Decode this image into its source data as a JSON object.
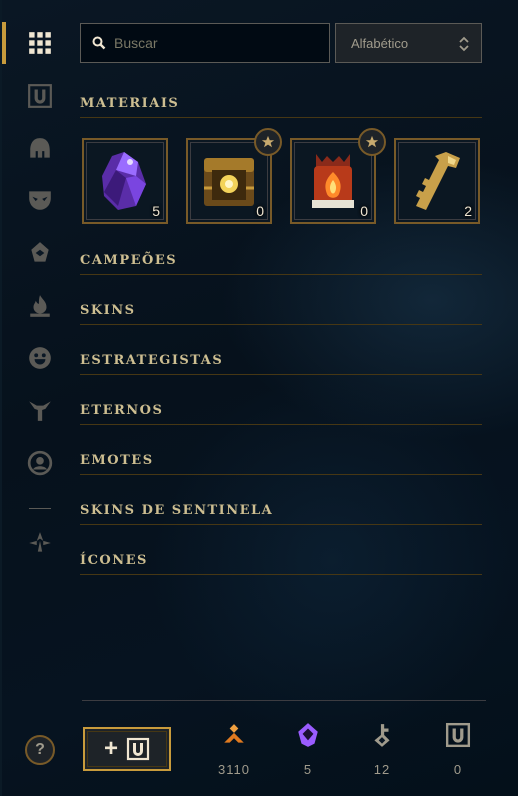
{
  "search": {
    "placeholder": "Buscar"
  },
  "sort": {
    "selected": "Alfabético"
  },
  "rail": {
    "items": [
      {
        "name": "all-grid-icon",
        "active": true
      },
      {
        "name": "vault-chest-icon"
      },
      {
        "name": "helmet-icon"
      },
      {
        "name": "mask-icon"
      },
      {
        "name": "ward-icon"
      },
      {
        "name": "flame-icon"
      },
      {
        "name": "emote-face-icon"
      },
      {
        "name": "eternals-icon"
      },
      {
        "name": "profile-icon"
      },
      {
        "name": "arrows-icon"
      }
    ]
  },
  "sections": {
    "materials": "MATERIAIS",
    "champions": "CAMPEÕES",
    "skins": "SKINS",
    "tacticians": "ESTRATEGISTAS",
    "eternals": "ETERNOS",
    "emotes": "EMOTES",
    "ward_skins": "SKINS DE SENTINELA",
    "icons": "ÍCONES"
  },
  "materials": [
    {
      "name": "crystal-shard",
      "count": "5",
      "starred": false
    },
    {
      "name": "hextech-chest",
      "count": "0",
      "starred": true
    },
    {
      "name": "masterwork-chest",
      "count": "0",
      "starred": true
    },
    {
      "name": "hextech-key",
      "count": "2",
      "starred": false
    }
  ],
  "footer": {
    "help_label": "?",
    "add_label": "+",
    "currencies": [
      {
        "name": "blue-essence-icon",
        "value": "3110",
        "color": "#f0a040"
      },
      {
        "name": "mythic-essence-icon",
        "value": "5",
        "color": "#9a5cff"
      },
      {
        "name": "key-fragment-icon",
        "value": "12",
        "color": "#a09b8c"
      },
      {
        "name": "chest-icon",
        "value": "0",
        "color": "#a09b8c"
      }
    ]
  }
}
